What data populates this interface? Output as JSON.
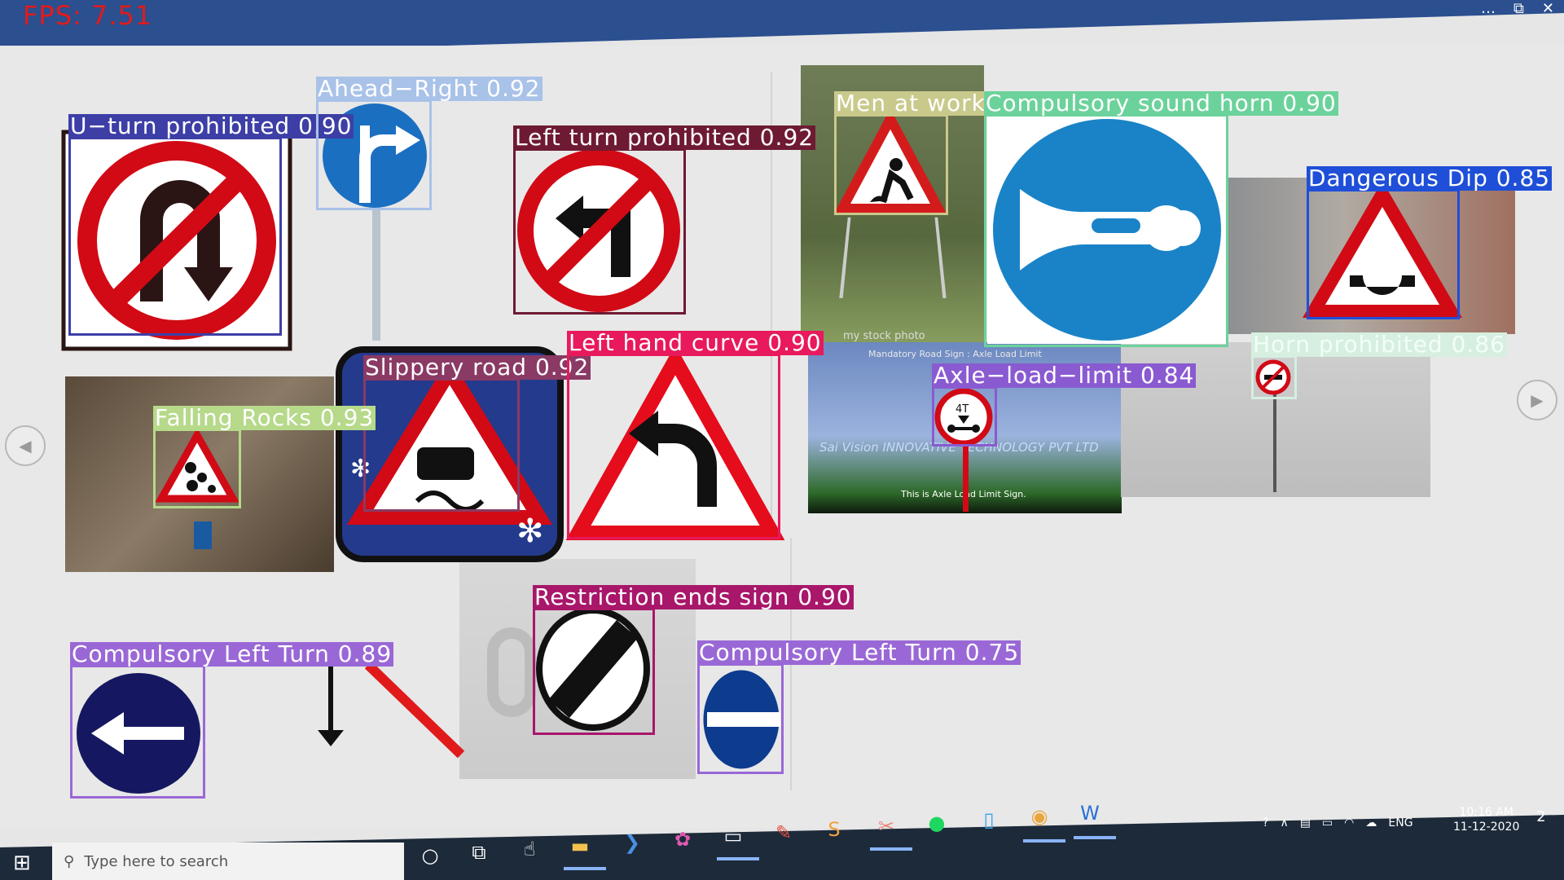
{
  "window": {
    "fps": "FPS: 7.51",
    "controls": [
      "…",
      "⧉",
      "✕"
    ]
  },
  "nav": {
    "prev": "◀",
    "next": "▶"
  },
  "photos": {
    "stock": "my stock photo",
    "mandatory_caption": "Mandatory Road Sign : Axle Load Limit",
    "axle_caption": "This is Axle Load Limit Sign.",
    "brand": "Sai Vision INNOVATIVE TECHNOLOGY PVT LTD",
    "axle_value": "4T"
  },
  "detections": [
    {
      "label": "U−turn prohibited 0.90",
      "color": "#3d3fa6"
    },
    {
      "label": "Ahead−Right 0.92",
      "color": "#a9c2e8"
    },
    {
      "label": "Left turn prohibited 0.92",
      "color": "#6e1a33"
    },
    {
      "label": "Men at work 0.91",
      "color": "#c9c98c"
    },
    {
      "label": "Compulsory sound horn 0.90",
      "color": "#6cd29b"
    },
    {
      "label": "Dangerous Dip 0.85",
      "color": "#1f4fd8"
    },
    {
      "label": "Slippery road 0.92",
      "color": "#8a3a64"
    },
    {
      "label": "Left hand curve 0.90",
      "color": "#e8195c"
    },
    {
      "label": "Axle−load−limit 0.84",
      "color": "#8a5ad1"
    },
    {
      "label": "Horn prohibited 0.86",
      "color": "#d6efe0"
    },
    {
      "label": "Falling Rocks 0.93",
      "color": "#b6d98a"
    },
    {
      "label": "Restriction ends sign 0.90",
      "color": "#a8176a"
    },
    {
      "label": "Compulsory Left Turn 0.89",
      "color": "#9a68d6"
    },
    {
      "label": "Compulsory Left Turn 0.75",
      "color": "#9a68d6"
    }
  ],
  "taskbar": {
    "search_placeholder": "Type here to search",
    "lang": "ENG",
    "time": "10:16 AM",
    "date": "11-12-2020",
    "notifications": "2"
  }
}
